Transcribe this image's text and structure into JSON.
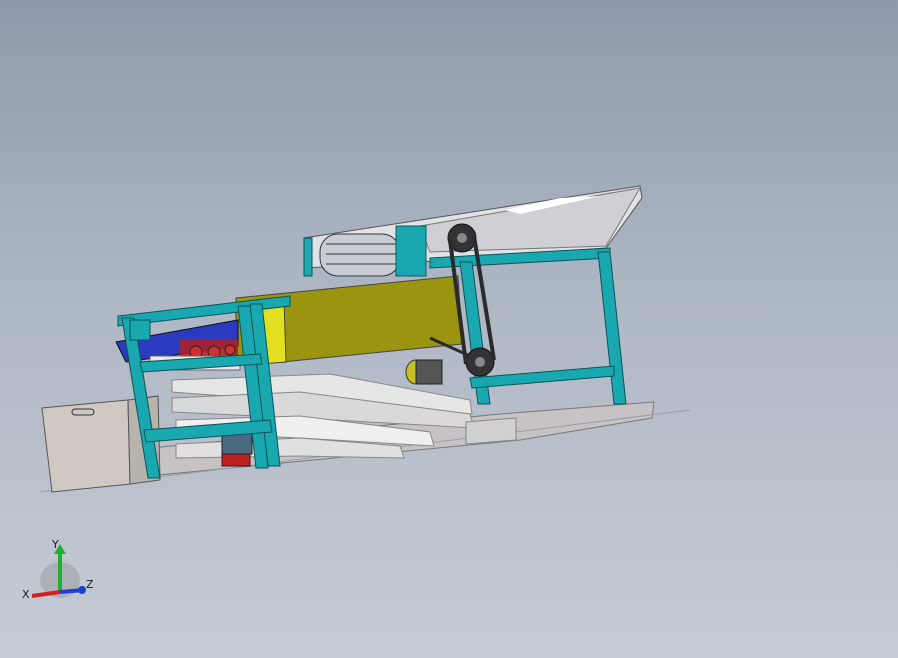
{
  "viewport": {
    "background_top": "#8e9aab",
    "background_bottom": "#c5ccd6"
  },
  "model": {
    "frame_color": "#1aa8b0",
    "hopper_color": "#d8d8dc",
    "yellow_panel_color": "#9a9410",
    "blue_tray_color": "#2a3bc0",
    "motor_color": "#c8c020",
    "chain_color": "#2a2a2a",
    "base_color": "#c8c4c4"
  },
  "triad": {
    "x_label": "X",
    "y_label": "Y",
    "z_label": "Z",
    "x_color": "#d02020",
    "y_color": "#20b030",
    "z_color": "#2040d0"
  }
}
